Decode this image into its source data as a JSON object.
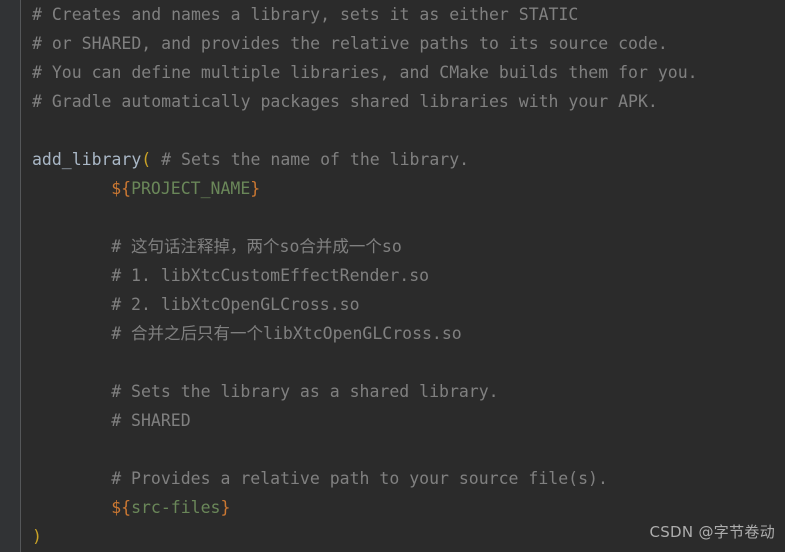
{
  "window": {
    "app": "code-editor",
    "theme": "darcula",
    "background_color": "#2b2b2b",
    "gutter_color": "#313335",
    "gutter_divider_color": "#555759"
  },
  "colors": {
    "comment": "#808080",
    "function": "#a9b7c6",
    "paren": "#c9a227",
    "dollar": "#cc7832",
    "brace": "#cc7832",
    "variable": "#6a8759"
  },
  "file": {
    "language": "CMake",
    "lines": [
      {
        "n": 1,
        "indent": 0,
        "segments": [
          {
            "type": "comment",
            "text": "# Creates and names a library, sets it as either STATIC"
          }
        ]
      },
      {
        "n": 2,
        "indent": 0,
        "segments": [
          {
            "type": "comment",
            "text": "# or SHARED, and provides the relative paths to its source code."
          }
        ]
      },
      {
        "n": 3,
        "indent": 0,
        "segments": [
          {
            "type": "comment",
            "text": "# You can define multiple libraries, and CMake builds them for you."
          }
        ]
      },
      {
        "n": 4,
        "indent": 0,
        "segments": [
          {
            "type": "comment",
            "text": "# Gradle automatically packages shared libraries with your APK."
          }
        ]
      },
      {
        "n": 5,
        "indent": 0,
        "segments": []
      },
      {
        "n": 6,
        "indent": 0,
        "segments": [
          {
            "type": "function",
            "text": "add_library"
          },
          {
            "type": "paren",
            "text": "("
          },
          {
            "type": "comment",
            "text": " # Sets the name of the library."
          }
        ]
      },
      {
        "n": 7,
        "indent": 8,
        "segments": [
          {
            "type": "dollar",
            "text": "$"
          },
          {
            "type": "brace",
            "text": "{"
          },
          {
            "type": "variable",
            "text": "PROJECT_NAME"
          },
          {
            "type": "brace",
            "text": "}"
          }
        ]
      },
      {
        "n": 8,
        "indent": 0,
        "segments": []
      },
      {
        "n": 9,
        "indent": 8,
        "segments": [
          {
            "type": "comment",
            "text": "# 这句话注释掉，两个so合并成一个so"
          }
        ]
      },
      {
        "n": 10,
        "indent": 8,
        "segments": [
          {
            "type": "comment",
            "text": "# 1. libXtcCustomEffectRender.so"
          }
        ]
      },
      {
        "n": 11,
        "indent": 8,
        "segments": [
          {
            "type": "comment",
            "text": "# 2. libXtcOpenGLCross.so"
          }
        ]
      },
      {
        "n": 12,
        "indent": 8,
        "segments": [
          {
            "type": "comment",
            "text": "# 合并之后只有一个libXtcOpenGLCross.so"
          }
        ]
      },
      {
        "n": 13,
        "indent": 0,
        "segments": []
      },
      {
        "n": 14,
        "indent": 8,
        "segments": [
          {
            "type": "comment",
            "text": "# Sets the library as a shared library."
          }
        ]
      },
      {
        "n": 15,
        "indent": 8,
        "segments": [
          {
            "type": "comment",
            "text": "# SHARED"
          }
        ]
      },
      {
        "n": 16,
        "indent": 0,
        "segments": []
      },
      {
        "n": 17,
        "indent": 8,
        "segments": [
          {
            "type": "comment",
            "text": "# Provides a relative path to your source file(s)."
          }
        ]
      },
      {
        "n": 18,
        "indent": 8,
        "segments": [
          {
            "type": "dollar",
            "text": "$"
          },
          {
            "type": "brace",
            "text": "{"
          },
          {
            "type": "variable",
            "text": "src-files"
          },
          {
            "type": "brace",
            "text": "}"
          }
        ]
      },
      {
        "n": 19,
        "indent": 0,
        "segments": [
          {
            "type": "paren",
            "text": ")"
          }
        ]
      }
    ]
  },
  "watermark": {
    "text": "CSDN @字节卷动"
  }
}
